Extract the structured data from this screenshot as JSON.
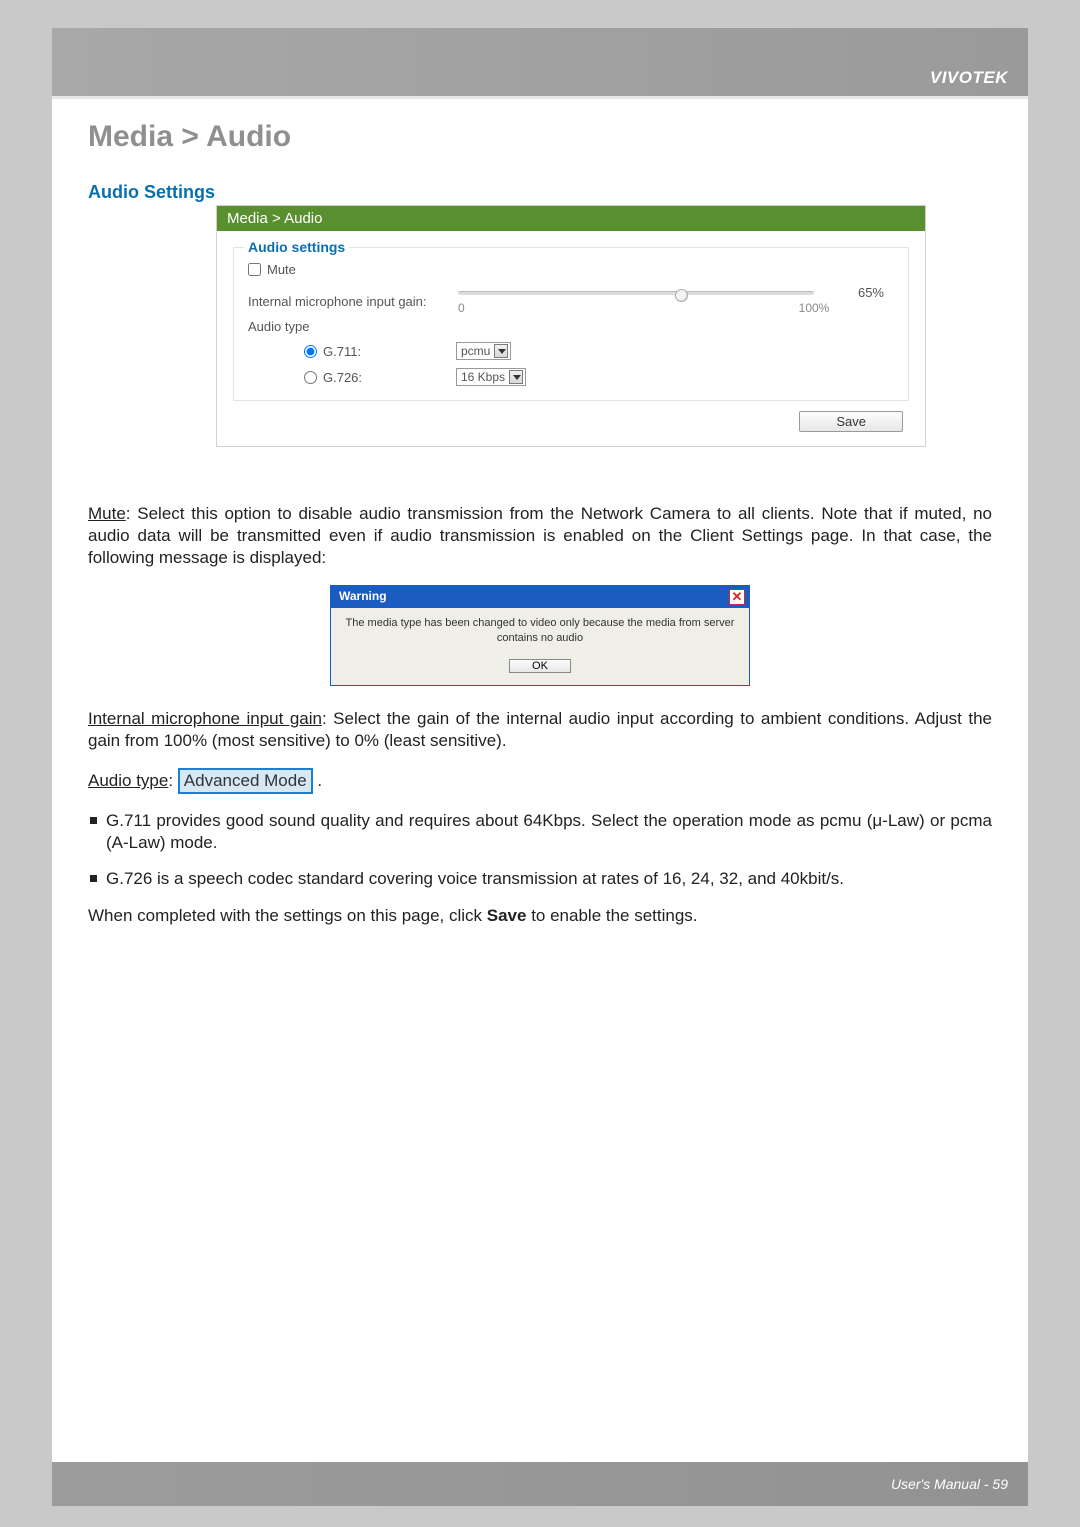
{
  "brand": "VIVOTEK",
  "page_title": "Media > Audio",
  "section_subtitle": "Audio Settings",
  "panel": {
    "header": "Media  > Audio",
    "legend": "Audio settings",
    "mute_label": "Mute",
    "gain_label": "Internal microphone input gain:",
    "slider_min": "0",
    "slider_max": "100%",
    "slider_value": "65%",
    "audio_type_label": "Audio type",
    "g711_label": "G.711:",
    "g711_select": "pcmu",
    "g726_label": "G.726:",
    "g726_select": "16 Kbps",
    "save_label": "Save"
  },
  "paragraphs": {
    "mute_heading": "Mute",
    "mute_text": ": Select this option to disable audio transmission from the Network Camera to all clients. Note that if muted, no audio data will be transmitted even if audio transmission is enabled on the Client Settings page. In that case, the following message is displayed:",
    "warning_title": "Warning",
    "warning_msg": "The media type has been changed to video only because the media from server contains no audio",
    "warning_ok": "OK",
    "gain_heading": "Internal microphone input gain",
    "gain_text": ": Select the gain of the internal audio input according to ambient conditions. Adjust the gain from 100% (most sensitive) to 0% (least sensitive).",
    "audiotype_heading": "Audio type",
    "audiotype_suffix": ": ",
    "adv_mode": "Advanced Mode",
    "adv_mode_period": " .",
    "bullet_g711": "G.711 provides good sound quality and requires about 64Kbps. Select the operation mode as pcmu (μ-Law) or pcma (A-Law) mode.",
    "bullet_g726": "G.726 is a speech codec standard covering voice transmission at rates of 16, 24, 32, and 40kbit/s.",
    "closing_pre": "When completed with the settings on this page, click ",
    "closing_bold": "Save",
    "closing_post": " to enable the settings."
  },
  "footer": {
    "label": "User's Manual - ",
    "page": "59"
  }
}
